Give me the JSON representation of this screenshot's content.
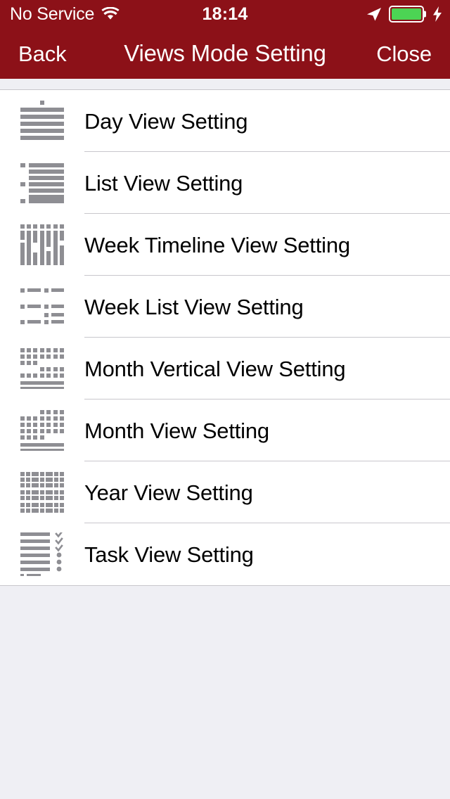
{
  "status_bar": {
    "carrier": "No Service",
    "wifi_icon": "wifi-icon",
    "time": "18:14",
    "location_icon": "location-arrow-icon",
    "battery_icon": "battery-charging-icon",
    "bolt_icon": "lightning-bolt-icon",
    "battery_level_percent": 100,
    "battery_color": "#4CD454"
  },
  "nav_bar": {
    "back_label": "Back",
    "title": "Views Mode Setting",
    "close_label": "Close",
    "background_color": "#8C1118",
    "text_color": "#FFFFFF"
  },
  "list": {
    "rows": [
      {
        "label": "Day View Setting",
        "icon": "day-view-icon"
      },
      {
        "label": "List View Setting",
        "icon": "list-view-icon"
      },
      {
        "label": "Week Timeline View Setting",
        "icon": "week-timeline-view-icon"
      },
      {
        "label": "Week List View Setting",
        "icon": "week-list-view-icon"
      },
      {
        "label": "Month Vertical View Setting",
        "icon": "month-vertical-view-icon"
      },
      {
        "label": "Month View Setting",
        "icon": "month-view-icon"
      },
      {
        "label": "Year View Setting",
        "icon": "year-view-icon"
      },
      {
        "label": "Task View Setting",
        "icon": "task-view-icon"
      }
    ],
    "icon_color": "#8E8E93",
    "separator_color": "#C8C7CC",
    "background_color": "#FFFFFF"
  },
  "page": {
    "background_color": "#EFEFF4"
  }
}
